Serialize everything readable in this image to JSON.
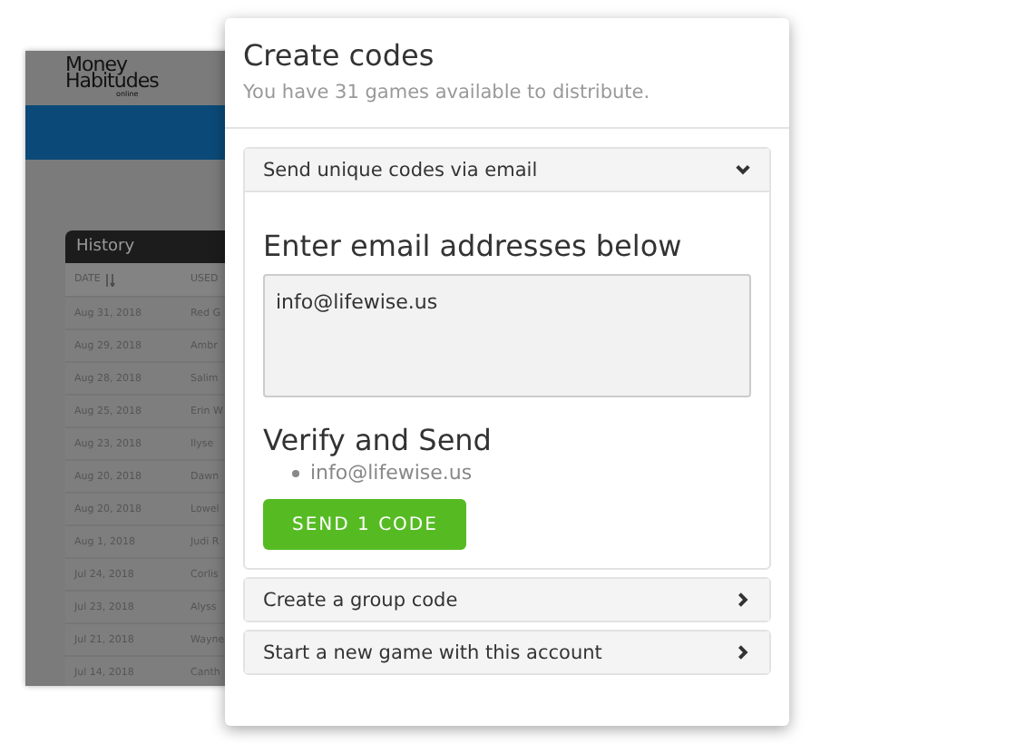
{
  "background_page": {
    "logo": {
      "line_1": "Money",
      "line_2": "Habitudes",
      "line_3": "online"
    },
    "history": {
      "title": "History",
      "columns": [
        "DATE",
        "USED"
      ],
      "rows": [
        [
          "Aug 31, 2018",
          "Red G"
        ],
        [
          "Aug 29, 2018",
          "Ambr"
        ],
        [
          "Aug 28, 2018",
          "Salim"
        ],
        [
          "Aug 25, 2018",
          "Erin W"
        ],
        [
          "Aug 23, 2018",
          "Ilyse"
        ],
        [
          "Aug 20, 2018",
          "Dawn"
        ],
        [
          "Aug 20, 2018",
          "Lowel"
        ],
        [
          "Aug 1, 2018",
          "Judi R"
        ],
        [
          "Jul 24, 2018",
          "Corlis"
        ],
        [
          "Jul 23, 2018",
          "Alyss"
        ],
        [
          "Jul 21, 2018",
          "Wayne"
        ],
        [
          "Jul 14, 2018",
          "Canth"
        ]
      ]
    }
  },
  "modal": {
    "title": "Create codes",
    "subtitle": "You have 31 games available to distribute.",
    "sections": [
      {
        "label": "Send unique codes via email",
        "expanded": true,
        "email_heading": "Enter email addresses below",
        "email_value": "info@lifewise.us",
        "verify_heading": "Verify and Send",
        "recipients": [
          "info@lifewise.us"
        ],
        "send_button": "SEND 1 CODE"
      },
      {
        "label": "Create a group code",
        "expanded": false
      },
      {
        "label": "Start a new game with this account",
        "expanded": false
      }
    ]
  }
}
